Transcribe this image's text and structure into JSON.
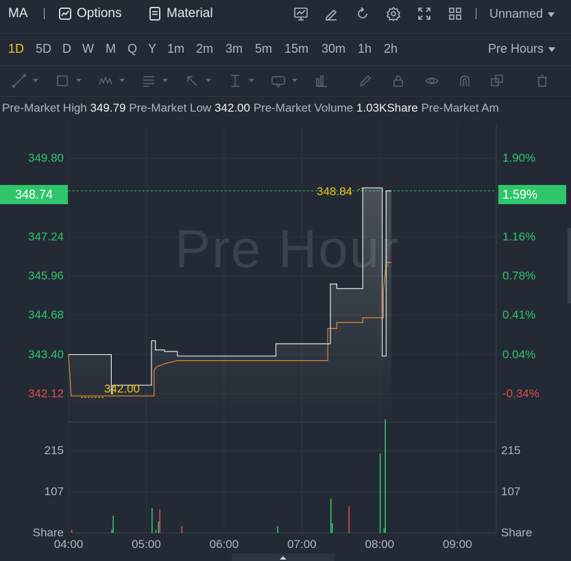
{
  "header": {
    "symbol": "MA",
    "options_label": "Options",
    "material_label": "Material",
    "layout_name": "Unnamed",
    "icons": [
      "chart-icon",
      "edit-icon",
      "refresh-icon",
      "settings-icon",
      "fullscreen-icon",
      "grid-layout-icon"
    ]
  },
  "timeframes": {
    "items": [
      "1D",
      "5D",
      "D",
      "W",
      "M",
      "Q",
      "Y",
      "1m",
      "2m",
      "3m",
      "5m",
      "15m",
      "30m",
      "1h",
      "2h"
    ],
    "active": "1D",
    "session_label": "Pre Hours"
  },
  "infobar": {
    "high_label": "Pre-Market High",
    "high_value": "349.79",
    "low_label": "Pre-Market Low",
    "low_value": "342.00",
    "volume_label": "Pre-Market Volume",
    "volume_value": "1.03KShare",
    "amount_label": "Pre-Market Am"
  },
  "colors": {
    "background": "#232a35",
    "up": "#2fc56a",
    "down": "#e04b4b",
    "avg_line": "#e8892a",
    "price_line": "#e6e9ee",
    "annotation": "#f5c518"
  },
  "chart": {
    "watermark": "Pre Hour",
    "current_price": "348.74",
    "current_pct": "1.59%",
    "high_annotation": "348.84",
    "low_annotation": "342.00",
    "price_ticks": [
      {
        "price": "349.80",
        "pct": "1.90%",
        "value": 349.8,
        "dir": "up"
      },
      {
        "price": "347.24",
        "pct": "1.16%",
        "value": 347.24,
        "dir": "up"
      },
      {
        "price": "345.96",
        "pct": "0.78%",
        "value": 345.96,
        "dir": "up"
      },
      {
        "price": "344.68",
        "pct": "0.41%",
        "value": 344.68,
        "dir": "up"
      },
      {
        "price": "343.40",
        "pct": "0.04%",
        "value": 343.4,
        "dir": "up"
      },
      {
        "price": "342.12",
        "pct": "-0.34%",
        "value": 342.12,
        "dir": "down"
      }
    ],
    "volume_ticks": [
      {
        "label": "215",
        "value": 215
      },
      {
        "label": "107",
        "value": 107
      },
      {
        "label": "Share",
        "value": 0
      }
    ],
    "x_ticks": [
      "04:00",
      "05:00",
      "06:00",
      "07:00",
      "08:00",
      "09:00"
    ]
  },
  "chart_data": {
    "type": "line",
    "price_range": [
      341.2,
      350.9
    ],
    "time_range": [
      "04:00",
      "09:30"
    ],
    "series": [
      {
        "name": "",
        "points": [
          [
            "04:00",
            343.4
          ],
          [
            "04:33",
            343.4
          ],
          [
            "04:33",
            342.12
          ],
          [
            "04:34",
            342.12
          ],
          [
            "04:34",
            342.4
          ],
          [
            "05:04",
            342.4
          ],
          [
            "05:04",
            343.85
          ],
          [
            "05:07",
            343.85
          ],
          [
            "05:07",
            343.55
          ],
          [
            "05:14",
            343.55
          ],
          [
            "05:14",
            343.5
          ],
          [
            "05:24",
            343.5
          ],
          [
            "05:24",
            343.35
          ],
          [
            "06:40",
            343.35
          ],
          [
            "06:40",
            343.75
          ],
          [
            "07:22",
            343.75
          ],
          [
            "07:22",
            345.7
          ],
          [
            "07:27",
            345.7
          ],
          [
            "07:27",
            345.55
          ],
          [
            "07:47",
            345.55
          ],
          [
            "07:47",
            348.84
          ],
          [
            "08:02",
            348.84
          ],
          [
            "08:02",
            343.35
          ],
          [
            "08:05",
            343.35
          ],
          [
            "08:05",
            348.74
          ],
          [
            "08:09",
            348.74
          ]
        ]
      },
      {
        "name": "",
        "points": [
          [
            "04:00",
            343.4
          ],
          [
            "04:02",
            342.05
          ],
          [
            "05:06",
            342.05
          ],
          [
            "05:06",
            342.9
          ],
          [
            "05:08",
            343.0
          ],
          [
            "05:14",
            343.1
          ],
          [
            "05:24",
            343.2
          ],
          [
            "07:20",
            343.2
          ],
          [
            "07:20",
            344.25
          ],
          [
            "07:27",
            344.25
          ],
          [
            "07:27",
            344.45
          ],
          [
            "07:47",
            344.45
          ],
          [
            "07:47",
            344.6
          ],
          [
            "08:03",
            344.6
          ],
          [
            "08:03",
            345.5
          ],
          [
            "08:05",
            346.4
          ],
          [
            "08:09",
            346.4
          ]
        ]
      }
    ],
    "volume": {
      "max": 280,
      "bars": [
        {
          "t": "04:02",
          "v": 8,
          "dir": "down"
        },
        {
          "t": "04:34",
          "v": 45,
          "dir": "up"
        },
        {
          "t": "04:33",
          "v": 8,
          "dir": "up"
        },
        {
          "t": "05:04",
          "v": 65,
          "dir": "up"
        },
        {
          "t": "05:07",
          "v": 8,
          "dir": "up"
        },
        {
          "t": "05:09",
          "v": 30,
          "dir": "up"
        },
        {
          "t": "05:10",
          "v": 62,
          "dir": "down"
        },
        {
          "t": "05:27",
          "v": 18,
          "dir": "down"
        },
        {
          "t": "06:41",
          "v": 18,
          "dir": "up"
        },
        {
          "t": "07:22",
          "v": 90,
          "dir": "up"
        },
        {
          "t": "07:23",
          "v": 25,
          "dir": "up"
        },
        {
          "t": "07:36",
          "v": 70,
          "dir": "down"
        },
        {
          "t": "08:00",
          "v": 208,
          "dir": "up"
        },
        {
          "t": "08:04",
          "v": 298,
          "dir": "up"
        },
        {
          "t": "08:03",
          "v": 12,
          "dir": "up"
        }
      ]
    }
  }
}
